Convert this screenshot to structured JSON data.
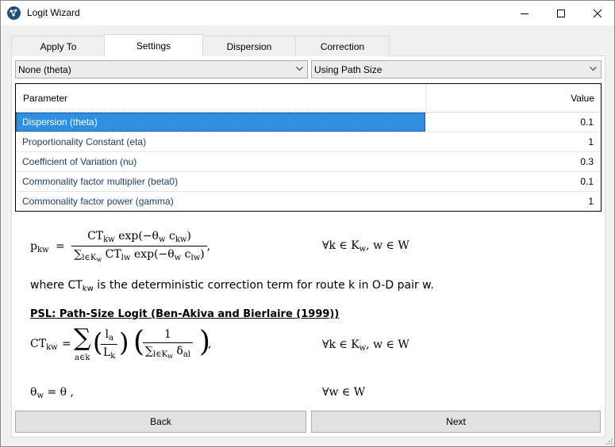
{
  "window": {
    "title": "Logit Wizard"
  },
  "tabs": [
    {
      "label": "Apply To",
      "active": false
    },
    {
      "label": "Settings",
      "active": true
    },
    {
      "label": "Dispersion",
      "active": false
    },
    {
      "label": "Correction",
      "active": false
    }
  ],
  "dropdowns": {
    "dispersion_mode": "None (theta)",
    "correction_mode": "Using Path Size"
  },
  "table": {
    "headers": {
      "parameter": "Parameter",
      "value": "Value"
    },
    "rows": [
      {
        "parameter": "Dispersion (theta)",
        "value": "0.1",
        "selected": true
      },
      {
        "parameter": "Proportionality Constant (eta)",
        "value": "1",
        "selected": false
      },
      {
        "parameter": "Coefficient of Variation (nu)",
        "value": "0.3",
        "selected": false
      },
      {
        "parameter": "Commonality factor multiplier (beta0)",
        "value": "0.1",
        "selected": false
      },
      {
        "parameter": "Commonality factor power (gamma)",
        "value": "1",
        "selected": false
      }
    ]
  },
  "math": {
    "eq1": {
      "lhs": "p",
      "lhs_sub": "kw",
      "num": "CT",
      "num_sub": "kw",
      "num_rest": " exp(−θ",
      "num_sub2": "w",
      "num_rest2": " c",
      "num_sub3": "kw",
      "num_end": ")",
      "den_sum": "∑",
      "den_sum_sub": "l∈K",
      "den_sum_sub2": "w",
      "den": " CT",
      "den_sub": "lw",
      "den_rest": " exp(−θ",
      "den_sub2": "w",
      "den_rest2": " c",
      "den_sub3": "lw",
      "den_end": ")",
      "tail": ",",
      "condition": "∀k ∈ K",
      "condition_sub": "w",
      "condition_rest": ", w ∈ W"
    },
    "explanation": {
      "before": "where CT",
      "sub": "kw",
      "after": " is the deterministic correction term for route k in O-D pair w."
    },
    "psl_heading": "PSL: Path-Size Logit (Ben-Akiva and Bierlaire (1999))",
    "eq2": {
      "lhs": "CT",
      "lhs_sub": "kw",
      "sum_sub": "a∈k",
      "la": "l",
      "la_sub": "a",
      "lk": "L",
      "lk_sub": "k",
      "one": "1",
      "den_sum_sub": "l∈K",
      "den_sum_sub2": "w",
      "delta": "δ",
      "delta_sub": "al",
      "tail": ",",
      "condition": "∀k ∈ K",
      "condition_sub": "w",
      "condition_rest": ", w ∈ W"
    },
    "eq3": {
      "lhs": "θ",
      "lhs_sub": "w",
      "rhs": " = θ ,",
      "condition": "∀w ∈ W"
    }
  },
  "buttons": {
    "back": "Back",
    "next": "Next"
  },
  "icons": {
    "app": "logit-wizard-app-icon",
    "minimize": "minimize-icon",
    "maximize": "maximize-icon",
    "close": "close-icon"
  }
}
